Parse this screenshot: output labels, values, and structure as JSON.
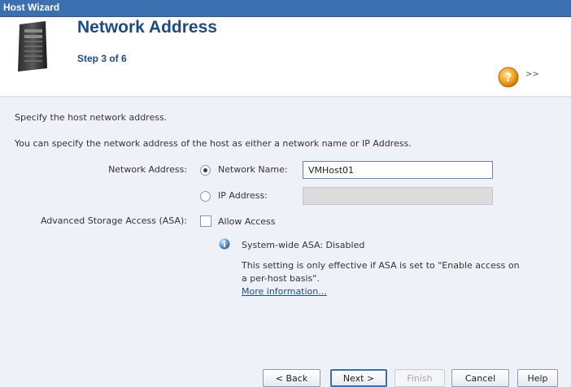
{
  "window": {
    "title": "Host Wizard"
  },
  "header": {
    "title": "Network Address",
    "step": "Step 3 of 6",
    "more_label": ">>"
  },
  "content": {
    "intro": "Specify the host network address.",
    "description": "You can specify the network address of the host as either a network name or IP Address.",
    "network_address_label": "Network Address:",
    "network_name_option": "Network Name:",
    "network_name_value": "VMHost01",
    "network_name_selected": true,
    "ip_address_option": "IP Address:",
    "ip_address_value": "",
    "asa_label": "Advanced Storage Access (ASA):",
    "allow_access_label": "Allow Access",
    "allow_access_checked": false,
    "asa_status": "System-wide ASA: Disabled",
    "asa_note_line1": "This setting is only effective if ASA is set to \"Enable access on",
    "asa_note_line2": "a per-host basis\".",
    "more_info_link": "More information..."
  },
  "buttons": {
    "back": "< Back",
    "next": "Next >",
    "finish": "Finish",
    "cancel": "Cancel",
    "help": "Help"
  },
  "colors": {
    "titlebar": "#3c6fb0",
    "heading": "#1f4a85",
    "content_bg": "#eef2f8"
  }
}
